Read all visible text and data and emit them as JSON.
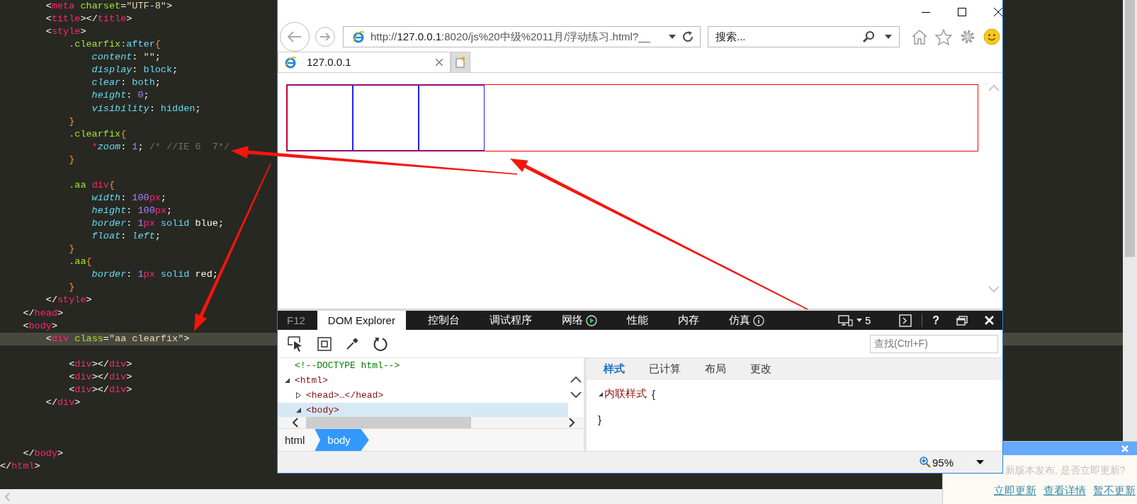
{
  "editor": {
    "lines": [
      {
        "current": false,
        "tokens": [
          {
            "kind": "punct",
            "text": "        <"
          },
          {
            "kind": "tag",
            "text": "meta"
          },
          {
            "kind": "attr",
            "text": " charset"
          },
          {
            "kind": "punct",
            "text": "="
          },
          {
            "kind": "string",
            "text": "\"UTF-8\""
          },
          {
            "kind": "punct",
            "text": ">"
          }
        ]
      },
      {
        "current": false,
        "tokens": [
          {
            "kind": "punct",
            "text": "        <"
          },
          {
            "kind": "tag",
            "text": "title"
          },
          {
            "kind": "punct",
            "text": "></"
          },
          {
            "kind": "tag",
            "text": "title"
          },
          {
            "kind": "punct",
            "text": ">"
          }
        ]
      },
      {
        "current": false,
        "tokens": [
          {
            "kind": "punct",
            "text": "        <"
          },
          {
            "kind": "tag",
            "text": "style"
          },
          {
            "kind": "punct",
            "text": ">"
          }
        ]
      },
      {
        "current": false,
        "tokens": [
          {
            "kind": "selector",
            "text": "            .clearfix"
          },
          {
            "kind": "pseudo",
            "text": ":after"
          },
          {
            "kind": "brace",
            "text": "{"
          }
        ]
      },
      {
        "current": false,
        "tokens": [
          {
            "kind": "prop",
            "text": "                content"
          },
          {
            "kind": "punct",
            "text": ": "
          },
          {
            "kind": "string",
            "text": "\"\""
          },
          {
            "kind": "punct",
            "text": ";"
          }
        ]
      },
      {
        "current": false,
        "tokens": [
          {
            "kind": "prop",
            "text": "                display"
          },
          {
            "kind": "punct",
            "text": ": "
          },
          {
            "kind": "value",
            "text": "block"
          },
          {
            "kind": "punct",
            "text": ";"
          }
        ]
      },
      {
        "current": false,
        "tokens": [
          {
            "kind": "prop",
            "text": "                clear"
          },
          {
            "kind": "punct",
            "text": ": "
          },
          {
            "kind": "value",
            "text": "both"
          },
          {
            "kind": "punct",
            "text": ";"
          }
        ]
      },
      {
        "current": false,
        "tokens": [
          {
            "kind": "prop",
            "text": "                height"
          },
          {
            "kind": "punct",
            "text": ": "
          },
          {
            "kind": "number",
            "text": "0"
          },
          {
            "kind": "punct",
            "text": ";"
          }
        ]
      },
      {
        "current": false,
        "tokens": [
          {
            "kind": "prop",
            "text": "                visibility"
          },
          {
            "kind": "punct",
            "text": ": "
          },
          {
            "kind": "value",
            "text": "hidden"
          },
          {
            "kind": "punct",
            "text": ";"
          }
        ]
      },
      {
        "current": false,
        "tokens": [
          {
            "kind": "brace",
            "text": "            }"
          }
        ]
      },
      {
        "current": false,
        "tokens": [
          {
            "kind": "selector",
            "text": "            .clearfix"
          },
          {
            "kind": "brace",
            "text": "{"
          }
        ]
      },
      {
        "current": false,
        "tokens": [
          {
            "kind": "star",
            "text": "                *"
          },
          {
            "kind": "prop",
            "text": "zoom"
          },
          {
            "kind": "punct",
            "text": ": "
          },
          {
            "kind": "number",
            "text": "1"
          },
          {
            "kind": "punct",
            "text": "; "
          },
          {
            "kind": "comment",
            "text": "/* //IE 6  7*/"
          }
        ]
      },
      {
        "current": false,
        "tokens": [
          {
            "kind": "brace",
            "text": "            }"
          }
        ]
      },
      {
        "current": false
      },
      {
        "current": false,
        "tokens": [
          {
            "kind": "selector",
            "text": "            .aa "
          },
          {
            "kind": "tag",
            "text": "div"
          },
          {
            "kind": "brace",
            "text": "{"
          }
        ]
      },
      {
        "current": false,
        "tokens": [
          {
            "kind": "prop",
            "text": "                width"
          },
          {
            "kind": "punct",
            "text": ": "
          },
          {
            "kind": "number",
            "text": "100"
          },
          {
            "kind": "unit",
            "text": "px"
          },
          {
            "kind": "punct",
            "text": ";"
          }
        ]
      },
      {
        "current": false,
        "tokens": [
          {
            "kind": "prop",
            "text": "                height"
          },
          {
            "kind": "punct",
            "text": ": "
          },
          {
            "kind": "number",
            "text": "100"
          },
          {
            "kind": "unit",
            "text": "px"
          },
          {
            "kind": "punct",
            "text": ";"
          }
        ]
      },
      {
        "current": false,
        "tokens": [
          {
            "kind": "prop",
            "text": "                border"
          },
          {
            "kind": "punct",
            "text": ": "
          },
          {
            "kind": "number",
            "text": "1"
          },
          {
            "kind": "unit",
            "text": "px"
          },
          {
            "kind": "value",
            "text": " solid "
          },
          {
            "kind": "plain",
            "text": "blue"
          },
          {
            "kind": "punct",
            "text": ";"
          }
        ]
      },
      {
        "current": false,
        "tokens": [
          {
            "kind": "prop",
            "text": "                float"
          },
          {
            "kind": "punct",
            "text": ": "
          },
          {
            "kind": "italic-value",
            "text": "left"
          },
          {
            "kind": "punct",
            "text": ";"
          }
        ]
      },
      {
        "current": false,
        "tokens": [
          {
            "kind": "brace",
            "text": "            }"
          }
        ]
      },
      {
        "current": false,
        "tokens": [
          {
            "kind": "selector",
            "text": "            .aa"
          },
          {
            "kind": "brace",
            "text": "{"
          }
        ]
      },
      {
        "current": false,
        "tokens": [
          {
            "kind": "prop",
            "text": "                border"
          },
          {
            "kind": "punct",
            "text": ": "
          },
          {
            "kind": "number",
            "text": "1"
          },
          {
            "kind": "unit",
            "text": "px"
          },
          {
            "kind": "value",
            "text": " solid "
          },
          {
            "kind": "plain",
            "text": "red"
          },
          {
            "kind": "punct",
            "text": ";"
          }
        ]
      },
      {
        "current": false,
        "tokens": [
          {
            "kind": "brace",
            "text": "            }"
          }
        ]
      },
      {
        "current": false,
        "tokens": [
          {
            "kind": "punct",
            "text": "        </"
          },
          {
            "kind": "tag",
            "text": "style"
          },
          {
            "kind": "punct",
            "text": ">"
          }
        ]
      },
      {
        "current": false,
        "tokens": [
          {
            "kind": "punct",
            "text": "    </"
          },
          {
            "kind": "tag",
            "text": "head"
          },
          {
            "kind": "punct",
            "text": ">"
          }
        ]
      },
      {
        "current": false,
        "tokens": [
          {
            "kind": "punct",
            "text": "    <"
          },
          {
            "kind": "tag",
            "text": "body"
          },
          {
            "kind": "punct",
            "text": ">"
          }
        ]
      },
      {
        "current": true,
        "tokens": [
          {
            "kind": "punct",
            "text": "        <"
          },
          {
            "kind": "tag",
            "text": "div"
          },
          {
            "kind": "attr",
            "text": " class"
          },
          {
            "kind": "punct",
            "text": "="
          },
          {
            "kind": "string",
            "text": "\"aa clearfix\""
          },
          {
            "kind": "punct",
            "text": ">"
          }
        ]
      },
      {
        "current": false
      },
      {
        "current": false,
        "tokens": [
          {
            "kind": "punct",
            "text": "            <"
          },
          {
            "kind": "tag",
            "text": "div"
          },
          {
            "kind": "punct",
            "text": "></"
          },
          {
            "kind": "tag",
            "text": "div"
          },
          {
            "kind": "punct",
            "text": ">"
          }
        ]
      },
      {
        "current": false,
        "tokens": [
          {
            "kind": "punct",
            "text": "            <"
          },
          {
            "kind": "tag",
            "text": "div"
          },
          {
            "kind": "punct",
            "text": "></"
          },
          {
            "kind": "tag",
            "text": "div"
          },
          {
            "kind": "punct",
            "text": ">"
          }
        ]
      },
      {
        "current": false,
        "tokens": [
          {
            "kind": "punct",
            "text": "            <"
          },
          {
            "kind": "tag",
            "text": "div"
          },
          {
            "kind": "punct",
            "text": "></"
          },
          {
            "kind": "tag",
            "text": "div"
          },
          {
            "kind": "punct",
            "text": ">"
          }
        ]
      },
      {
        "current": false,
        "tokens": [
          {
            "kind": "punct",
            "text": "        </"
          },
          {
            "kind": "tag",
            "text": "div"
          },
          {
            "kind": "punct",
            "text": ">"
          }
        ]
      },
      {
        "current": false
      },
      {
        "current": false
      },
      {
        "current": false
      },
      {
        "current": false,
        "tokens": [
          {
            "kind": "punct",
            "text": "    </"
          },
          {
            "kind": "tag",
            "text": "body"
          },
          {
            "kind": "punct",
            "text": ">"
          }
        ]
      },
      {
        "current": false,
        "tokens": [
          {
            "kind": "punct",
            "text": "</"
          },
          {
            "kind": "tag",
            "text": "html"
          },
          {
            "kind": "punct",
            "text": ">"
          }
        ]
      }
    ]
  },
  "browser": {
    "address": {
      "scheme": "http://",
      "host": "127.0.0.1",
      "rest": ":8020/js%20中级%2011月/浮动练习.html?__"
    },
    "search_placeholder": "搜索...",
    "tabs": [
      {
        "label": "127.0.0.1",
        "selected": true
      }
    ],
    "devtools": {
      "f12_label": "F12",
      "tabs": [
        {
          "label": "DOM Explorer",
          "selected": true,
          "kind": "text"
        },
        {
          "label": "控制台",
          "selected": false,
          "kind": "text"
        },
        {
          "label": "调试程序",
          "selected": false,
          "kind": "text"
        },
        {
          "label": "网络",
          "selected": false,
          "kind": "play"
        },
        {
          "label": "性能",
          "selected": false,
          "kind": "text"
        },
        {
          "label": "内存",
          "selected": false,
          "kind": "text"
        },
        {
          "label": "仿真",
          "selected": false,
          "kind": "info"
        }
      ],
      "target_count": "5",
      "help_label": "?",
      "find_placeholder": "查找(Ctrl+F)",
      "dom_tree": [
        {
          "kind": "comment",
          "text": "<!--DOCTYPE html-->",
          "selected": false
        },
        {
          "kind": "element",
          "text": "<html>",
          "expanded": true,
          "selected": false,
          "children": [
            {
              "kind": "element",
              "text": "<head>…</head>",
              "expanded": false,
              "selected": false
            },
            {
              "kind": "element",
              "text": "<body>",
              "expanded": true,
              "selected": true
            }
          ]
        }
      ],
      "breadcrumb": [
        {
          "label": "html",
          "selected": false
        },
        {
          "label": "body",
          "selected": true
        }
      ],
      "style_tabs": [
        {
          "label": "样式",
          "selected": true
        },
        {
          "label": "已计算",
          "selected": false
        },
        {
          "label": "布局",
          "selected": false
        },
        {
          "label": "更改",
          "selected": false
        }
      ],
      "style_rule": {
        "name": "内联样式",
        "open": "{",
        "close": "}",
        "expanded": true
      },
      "zoom": "95%"
    }
  },
  "notification": {
    "message": "新版本发布, 是否立即更新?",
    "links": [
      "立即更新",
      "查看详情",
      "暂不更新"
    ]
  }
}
